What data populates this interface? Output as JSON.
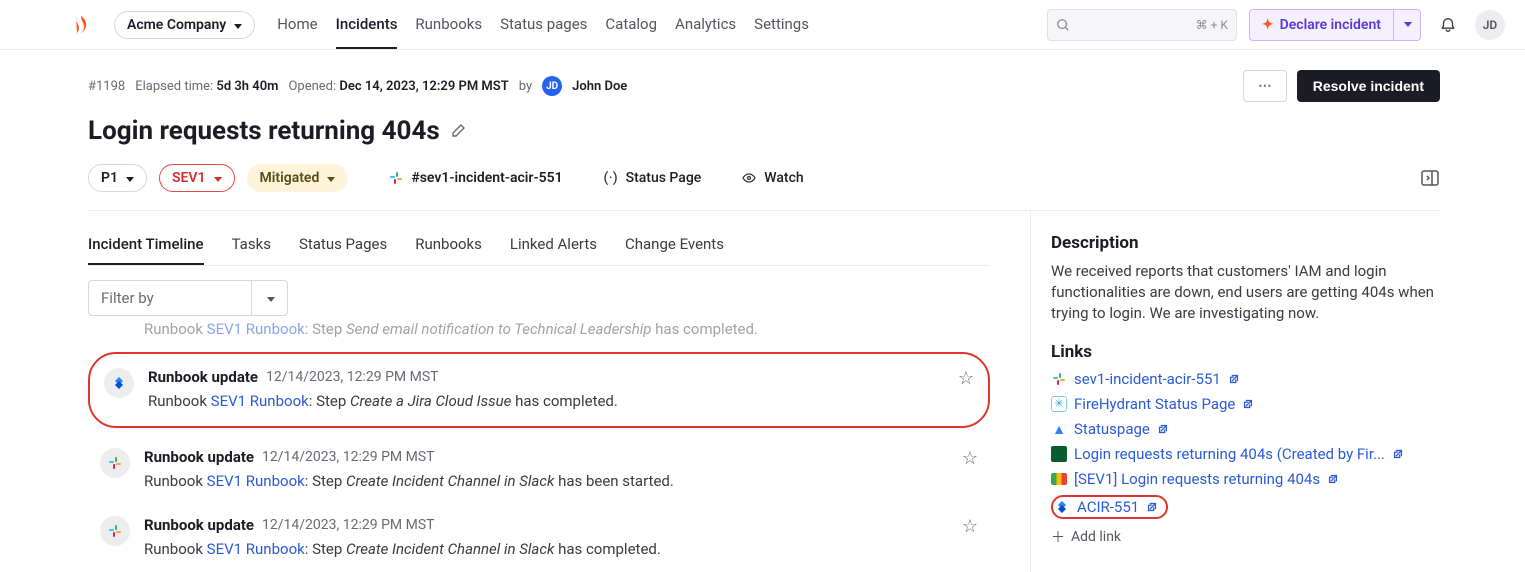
{
  "nav": {
    "org": "Acme Company",
    "links": [
      "Home",
      "Incidents",
      "Runbooks",
      "Status pages",
      "Catalog",
      "Analytics",
      "Settings"
    ],
    "active": "Incidents",
    "search_kbd": "⌘ + K",
    "declare_label": "Declare incident",
    "avatar": "JD"
  },
  "incident": {
    "id": "#1198",
    "elapsed_label": "Elapsed time:",
    "elapsed": "5d 3h 40m",
    "opened_label": "Opened:",
    "opened": "Dec 14, 2023, 12:29 PM MST",
    "by_label": "by",
    "creator_initials": "JD",
    "creator": "John Doe",
    "more_label": "⋯",
    "resolve_label": "Resolve incident",
    "title": "Login requests returning 404s",
    "priority": "P1",
    "severity": "SEV1",
    "state": "Mitigated",
    "slack_channel": "#sev1-incident-acir-551",
    "status_page_label": "Status Page",
    "watch_label": "Watch"
  },
  "tabs": [
    "Incident Timeline",
    "Tasks",
    "Status Pages",
    "Runbooks",
    "Linked Alerts",
    "Change Events"
  ],
  "active_tab": "Incident Timeline",
  "filter_placeholder": "Filter by",
  "cutoff": {
    "prefix": "Runbook ",
    "runbook": "SEV1 Runbook",
    "colon": ": Step ",
    "step": "Send email notification to Technical Leadership",
    "suffix": " has completed."
  },
  "events": [
    {
      "title": "Runbook update",
      "ts": "12/14/2023, 12:29 PM MST",
      "prefix": "Runbook ",
      "runbook": "SEV1 Runbook",
      "colon": ": Step ",
      "step": "Create a Jira Cloud Issue",
      "suffix": " has completed.",
      "icon": "jira",
      "highlight": true
    },
    {
      "title": "Runbook update",
      "ts": "12/14/2023, 12:29 PM MST",
      "prefix": "Runbook ",
      "runbook": "SEV1 Runbook",
      "colon": ": Step ",
      "step": "Create Incident Channel in Slack",
      "suffix": " has been started.",
      "icon": "slack",
      "highlight": false
    },
    {
      "title": "Runbook update",
      "ts": "12/14/2023, 12:29 PM MST",
      "prefix": "Runbook ",
      "runbook": "SEV1 Runbook",
      "colon": ": Step ",
      "step": "Create Incident Channel in Slack",
      "suffix": " has completed.",
      "icon": "slack",
      "highlight": false
    }
  ],
  "sidebar": {
    "description_h": "Description",
    "description": "We received reports that customers' IAM and login functionalities are down, end users are getting 404s when trying to login. We are investigating now.",
    "links_h": "Links",
    "links": [
      {
        "icon": "slack",
        "label": "sev1-incident-acir-551",
        "highlight": false
      },
      {
        "icon": "fh",
        "label": "FireHydrant Status Page",
        "highlight": false
      },
      {
        "icon": "atl",
        "label": "Statuspage",
        "highlight": false
      },
      {
        "icon": "pd",
        "label": "Login requests returning 404s (Created by Fir...",
        "highlight": false
      },
      {
        "icon": "meet",
        "label": "[SEV1] Login requests returning 404s",
        "highlight": false
      },
      {
        "icon": "jira",
        "label": "ACIR-551",
        "highlight": true
      }
    ],
    "add_link": "Add link"
  }
}
